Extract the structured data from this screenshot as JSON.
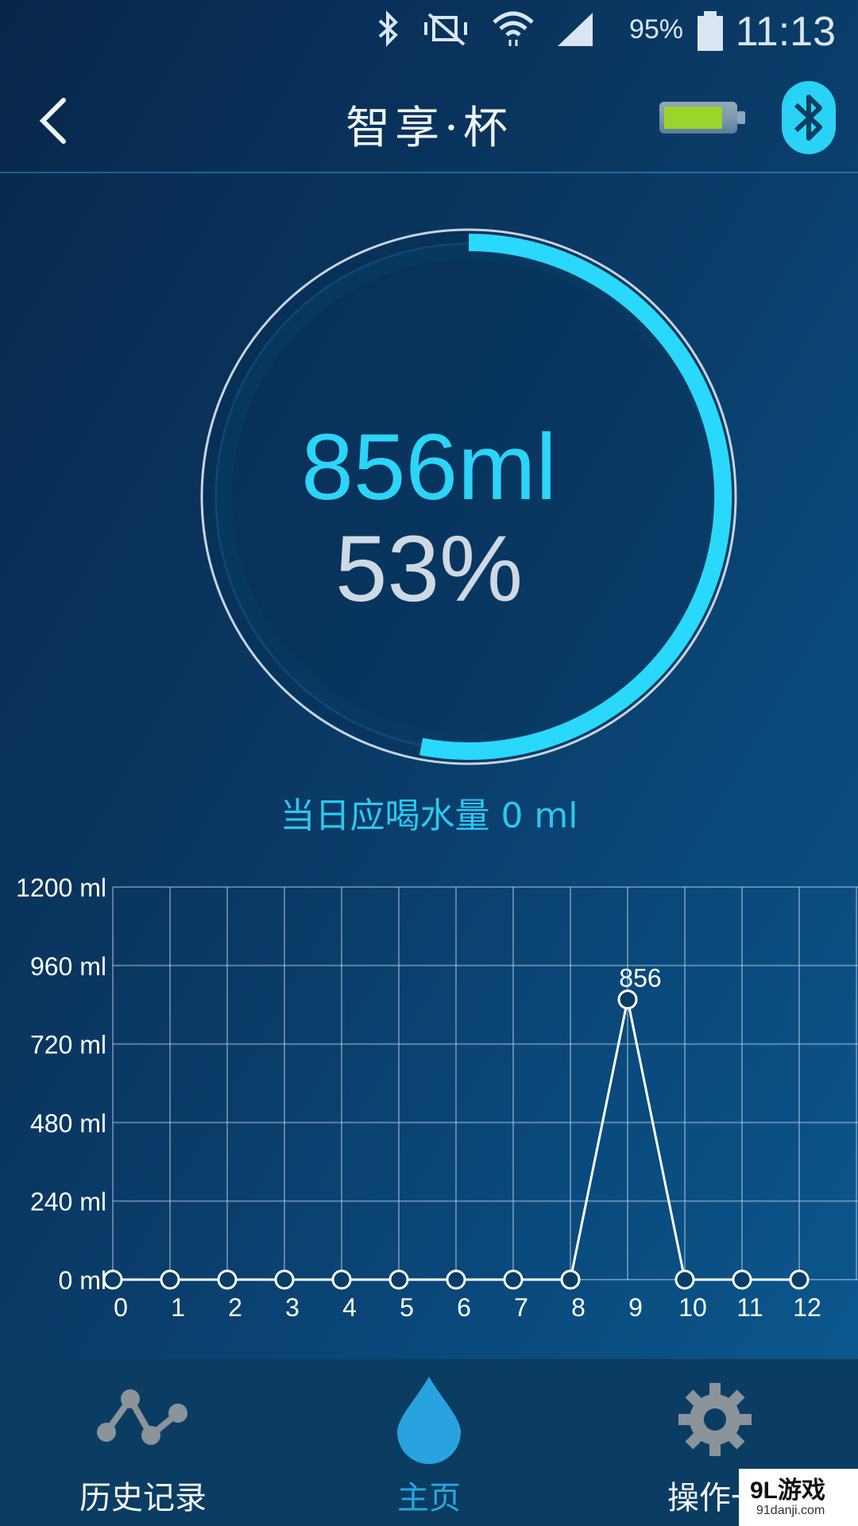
{
  "status_bar": {
    "battery_percent": "95%",
    "time": "11:13",
    "icons": [
      "bluetooth-icon",
      "vibrate-mute-icon",
      "wifi-icon",
      "signal-icon",
      "battery-icon"
    ]
  },
  "header": {
    "title": "智享·杯",
    "device_battery_level": 0.85,
    "colors": {
      "accent": "#2cd4f7",
      "battery_fill": "#9bd42a"
    }
  },
  "main": {
    "amount": "856ml",
    "percent": "53%",
    "progress": 0.53,
    "daily_target": "当日应喝水量 0 ml"
  },
  "chart_data": {
    "type": "line",
    "x": [
      0,
      1,
      2,
      3,
      4,
      5,
      6,
      7,
      8,
      9,
      10,
      11,
      12
    ],
    "series": [
      {
        "values": [
          0,
          0,
          0,
          0,
          0,
          0,
          0,
          0,
          0,
          856,
          0,
          0,
          0
        ]
      }
    ],
    "point_labels": {
      "9": "856"
    },
    "ylim": [
      0,
      1200
    ],
    "yticks": [
      0,
      240,
      480,
      720,
      960,
      1200
    ],
    "ytick_labels": [
      "0 ml",
      "240 ml",
      "480 ml",
      "720 ml",
      "960 ml",
      "1200 ml"
    ],
    "grid": true
  },
  "bottom_nav": {
    "items": [
      {
        "label": "历史记录",
        "icon": "history-chart-icon"
      },
      {
        "label": "主页",
        "icon": "water-drop-icon",
        "active": true
      },
      {
        "label": "操作一",
        "icon": "gear-icon"
      }
    ],
    "watermark": {
      "big": "9L游戏",
      "small": "91danji.com"
    }
  }
}
